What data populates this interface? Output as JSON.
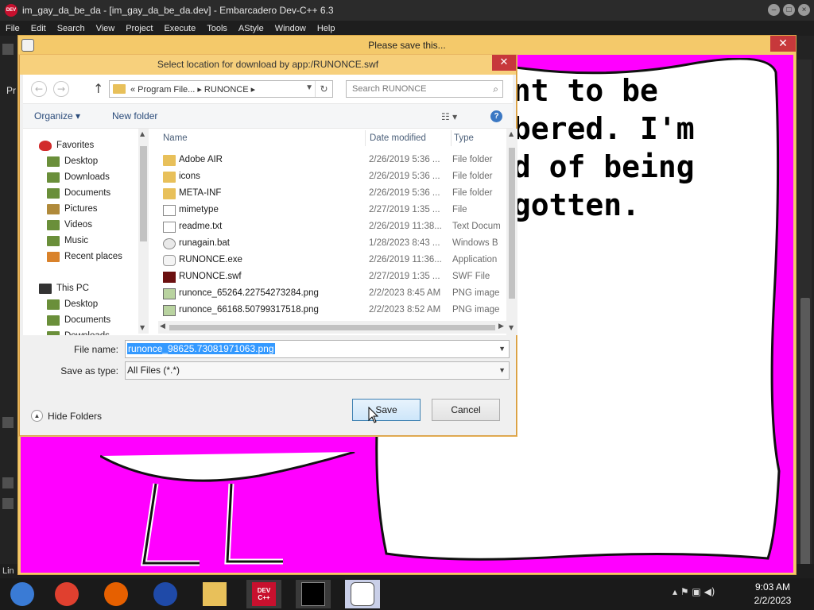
{
  "ide": {
    "title": "im_gay_da_be_da - [im_gay_da_be_da.dev] - Embarcadero Dev-C++ 6.3",
    "menu": [
      "File",
      "Edit",
      "Search",
      "View",
      "Project",
      "Execute",
      "Tools",
      "AStyle",
      "Window",
      "Help"
    ],
    "status_fragment": "Lin",
    "left_fragment": "Pr"
  },
  "flash_window": {
    "title": "Please save this...",
    "close_glyph": "✕",
    "story_text": "ant to be\nmbered. I'm\nid of being\nrgotten."
  },
  "dialog": {
    "title": "Select location for download by app:/RUNONCE.swf",
    "close_glyph": "✕",
    "nav": {
      "back": "←",
      "forward": "→",
      "up": "↑",
      "address_path": "« Program File... ▸ RUNONCE ▸",
      "search_placeholder": "Search RUNONCE"
    },
    "toolbar": {
      "organize": "Organize ▾",
      "new_folder": "New folder",
      "view_glyph": "☷ ▾",
      "help_glyph": "?"
    },
    "nav_pane": {
      "items": [
        {
          "label": "Favorites",
          "icon": "heart-icon",
          "color": "#d22b2b"
        },
        {
          "label": "Desktop",
          "icon": "desktop-folder-icon",
          "color": "#6a8f3a"
        },
        {
          "label": "Downloads",
          "icon": "downloads-folder-icon",
          "color": "#6a8f3a"
        },
        {
          "label": "Documents",
          "icon": "documents-folder-icon",
          "color": "#6a8f3a"
        },
        {
          "label": "Pictures",
          "icon": "pictures-folder-icon",
          "color": "#b08a3a"
        },
        {
          "label": "Videos",
          "icon": "videos-folder-icon",
          "color": "#6a8f3a"
        },
        {
          "label": "Music",
          "icon": "music-folder-icon",
          "color": "#6a8f3a"
        },
        {
          "label": "Recent places",
          "icon": "recent-places-icon",
          "color": "#d9822b"
        },
        {
          "label": "This PC",
          "icon": "computer-icon",
          "color": "#333333"
        },
        {
          "label": "Desktop",
          "icon": "desktop-folder-icon",
          "color": "#6a8f3a"
        },
        {
          "label": "Documents",
          "icon": "documents-folder-icon",
          "color": "#6a8f3a"
        },
        {
          "label": "Downloads",
          "icon": "downloads-folder-icon",
          "color": "#6a8f3a"
        }
      ]
    },
    "columns": {
      "name": "Name",
      "date": "Date modified",
      "type": "Type"
    },
    "files": [
      {
        "name": "Adobe AIR",
        "date": "2/26/2019 5:36 ...",
        "type": "File folder",
        "kind": "folder"
      },
      {
        "name": "icons",
        "date": "2/26/2019 5:36 ...",
        "type": "File folder",
        "kind": "folder"
      },
      {
        "name": "META-INF",
        "date": "2/26/2019 5:36 ...",
        "type": "File folder",
        "kind": "folder"
      },
      {
        "name": "mimetype",
        "date": "2/27/2019 1:35 ...",
        "type": "File",
        "kind": "file"
      },
      {
        "name": "readme.txt",
        "date": "2/26/2019 11:38...",
        "type": "Text Docum",
        "kind": "txt"
      },
      {
        "name": "runagain.bat",
        "date": "1/28/2023 8:43 ...",
        "type": "Windows B",
        "kind": "bat"
      },
      {
        "name": "RUNONCE.exe",
        "date": "2/26/2019 11:36...",
        "type": "Application",
        "kind": "exe"
      },
      {
        "name": "RUNONCE.swf",
        "date": "2/27/2019 1:35 ...",
        "type": "SWF File",
        "kind": "swf"
      },
      {
        "name": "runonce_65264.22754273284.png",
        "date": "2/2/2023 8:45 AM",
        "type": "PNG image",
        "kind": "png"
      },
      {
        "name": "runonce_66168.50799317518.png",
        "date": "2/2/2023 8:52 AM",
        "type": "PNG image",
        "kind": "png"
      }
    ],
    "filename_label": "File name:",
    "filename_value": "runonce_98625.73081971063.png",
    "savetype_label": "Save as type:",
    "savetype_value": "All Files (*.*)",
    "hide_folders": "Hide Folders",
    "save_button": "Save",
    "cancel_button": "Cancel"
  },
  "taskbar": {
    "apps": [
      {
        "name": "chrome-old-icon",
        "color": "#3a7bd5"
      },
      {
        "name": "chrome-icon",
        "color": "#e0402f"
      },
      {
        "name": "firefox-icon",
        "color": "#e66000"
      },
      {
        "name": "obama-logo-icon",
        "color": "#1f4aa8"
      },
      {
        "name": "file-explorer-icon",
        "color": "#e8c05a"
      },
      {
        "name": "devcpp-icon",
        "color": "#c8102e",
        "label": "DEV\nC++"
      },
      {
        "name": "console-icon",
        "color": "#000000"
      },
      {
        "name": "bunny-app-icon",
        "color": "#ffffff"
      }
    ],
    "time": "9:03 AM",
    "date": "2/2/2023",
    "tray_glyphs": "▴ ⚑ ▣ ◀)"
  }
}
